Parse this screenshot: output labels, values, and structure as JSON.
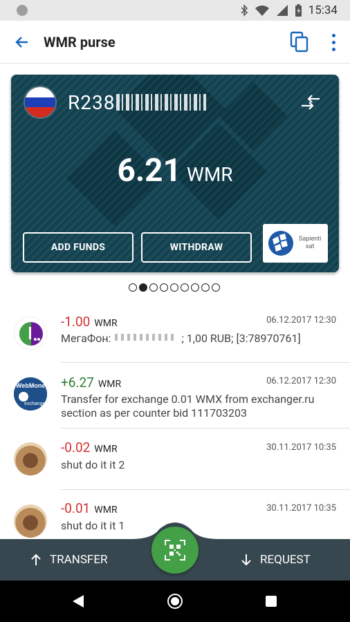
{
  "status_bar": {
    "time": "15:34"
  },
  "app_bar": {
    "title": "WMR purse",
    "back_icon": "arrow-left-icon",
    "copy_icon": "copy-icon",
    "menu_icon": "more-vertical-icon"
  },
  "purse": {
    "id_prefix": "R238",
    "balance": "6.21",
    "currency": "WMR",
    "add_funds_label": "ADD FUNDS",
    "withdraw_label": "WITHDRAW",
    "badge_line1": "Sapienti",
    "badge_line2": "sat"
  },
  "pager": {
    "count": 9,
    "active_index": 1
  },
  "transactions": [
    {
      "amount": "-1.00",
      "unit": "WMR",
      "date": "06.12.2017 12:30",
      "desc_prefix": "МегаФон:",
      "desc_suffix": "; 1,00 RUB; [3:78970761]",
      "avatar": "megafon-logo"
    },
    {
      "amount": "+6.27",
      "unit": "WMR",
      "date": "06.12.2017 12:30",
      "desc": "Transfer for exchange 0.01 WMX from exchanger.ru section as per counter bid 111703203",
      "avatar": "webmoney-exchange-logo"
    },
    {
      "amount": "-0.02",
      "unit": "WMR",
      "date": "30.11.2017 10:35",
      "desc": "shut do it it 2",
      "avatar": "cat-photo"
    },
    {
      "amount": "-0.01",
      "unit": "WMR",
      "date": "30.11.2017 10:35",
      "desc": "shut do it it 1",
      "avatar": "cat-photo"
    }
  ],
  "bottom_bar": {
    "transfer_label": "TRANSFER",
    "request_label": "REQUEST",
    "qr_icon": "qr-scan-icon"
  },
  "colors": {
    "card": "#124150",
    "negative": "#d32f2f",
    "positive": "#2e7d32",
    "fab": "#43a047",
    "bottom_bar": "#37474f",
    "accent": "#1565c0"
  }
}
